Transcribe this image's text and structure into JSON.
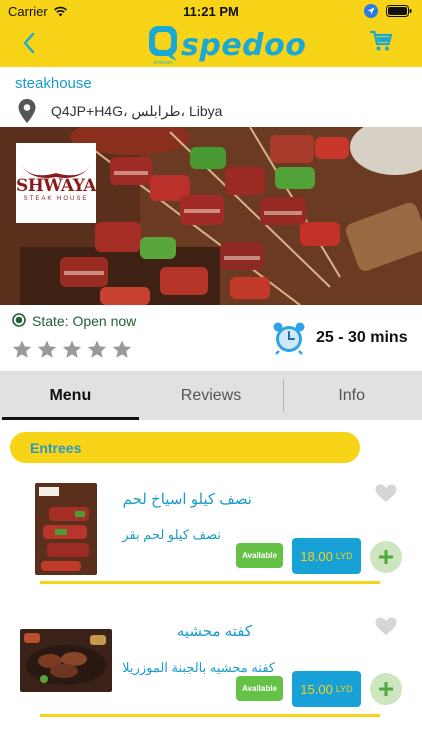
{
  "status_bar": {
    "carrier": "Carrier",
    "time": "11:21 PM"
  },
  "app": {
    "logo_text": "spedoo",
    "logo_badge": "Q",
    "logo_small": "SPEDOO"
  },
  "store": {
    "name": "steakhouse",
    "address": "Q4JP+H4G، طرابلس، Libya",
    "brand_name": "SHWAYA",
    "brand_sub": "STEAK HOUSE",
    "state": "State: Open now",
    "rating_stars": 0,
    "rating_max": 5,
    "delivery_time": "25 - 30 mins"
  },
  "tabs": [
    {
      "label": "Menu",
      "active": true
    },
    {
      "label": "Reviews",
      "active": false
    },
    {
      "label": "Info",
      "active": false
    }
  ],
  "section": {
    "title": "Entrees"
  },
  "items": [
    {
      "name": "نصف كيلو اسياخ لحم",
      "description": "نصف كيلو لحم بقر",
      "availability": "Available",
      "price": "18.00",
      "currency": "LYD",
      "favorite": false
    },
    {
      "name": "كفته محشيه",
      "description": "كفته محشيه بالجبنة الموزريلا",
      "availability": "Available",
      "price": "15.00",
      "currency": "LYD",
      "favorite": false
    }
  ],
  "colors": {
    "brand_yellow": "#f7d417",
    "brand_blue": "#18a1d6",
    "available_green": "#66c247",
    "state_green": "#215e3a"
  },
  "icons": {
    "back": "chevron-left-icon",
    "cart": "cart-icon",
    "location": "location-pin-icon",
    "alarm": "alarm-clock-icon",
    "favorite": "heart-icon",
    "add": "plus-icon"
  }
}
